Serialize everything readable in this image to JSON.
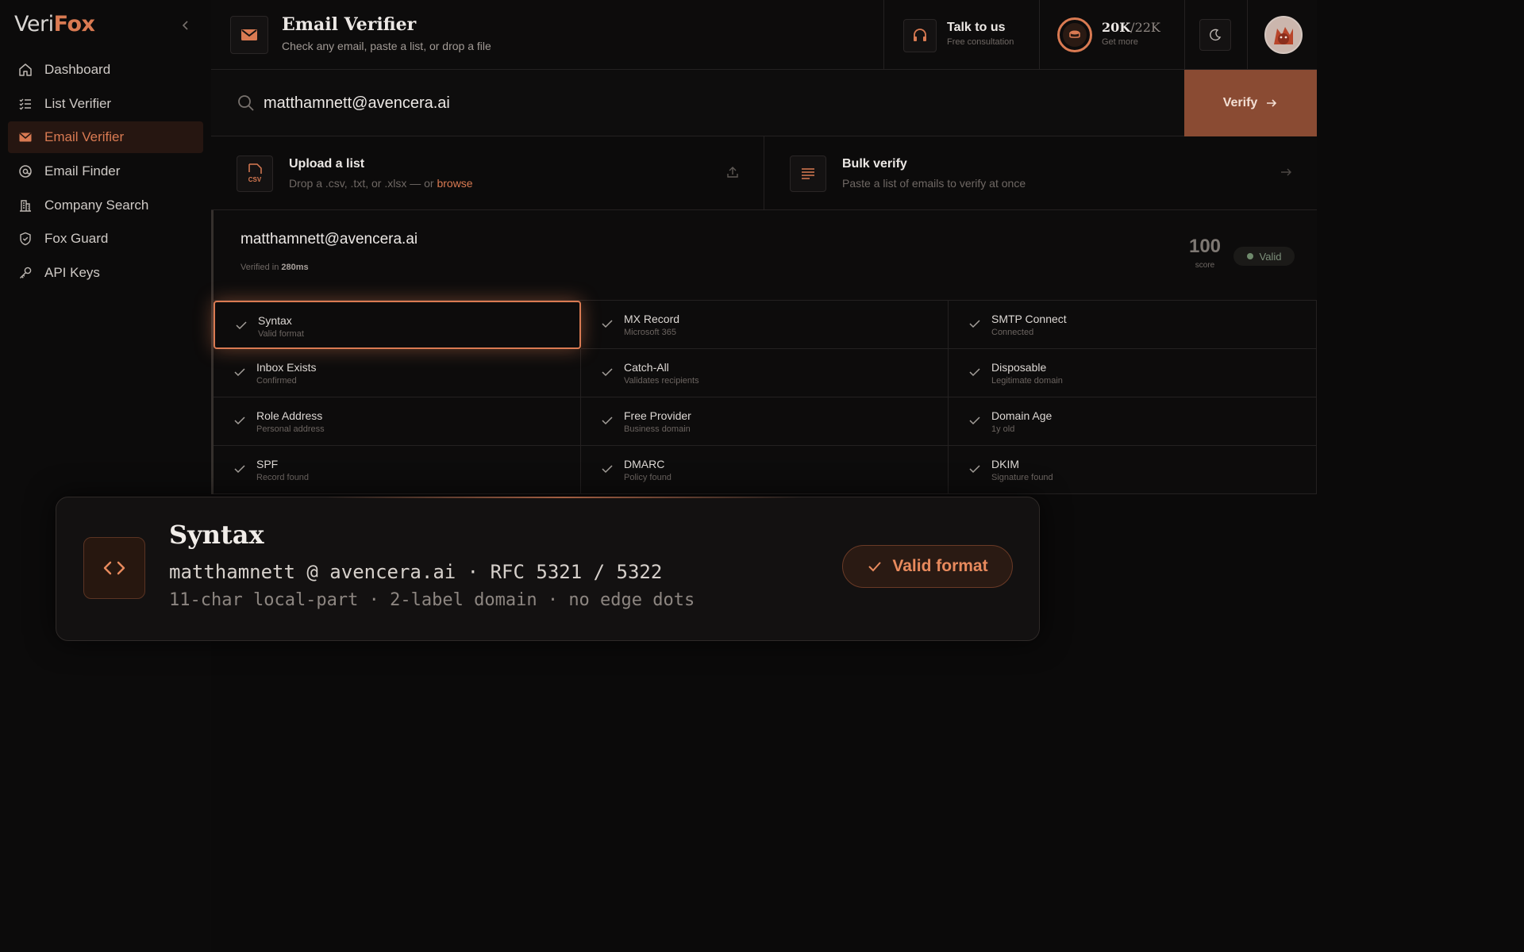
{
  "app": {
    "logo_part1": "Veri",
    "logo_part2": "Fox"
  },
  "colors": {
    "accent": "#d97a52",
    "verify_button": "#8a4b33",
    "background": "#0b0a0a",
    "valid_dot": "#6f8a6c"
  },
  "sidebar": {
    "items": [
      {
        "label": "Dashboard",
        "icon": "home-icon"
      },
      {
        "label": "List Verifier",
        "icon": "list-icon"
      },
      {
        "label": "Email Verifier",
        "icon": "mail-icon",
        "active": true
      },
      {
        "label": "Email Finder",
        "icon": "at-sign-icon"
      },
      {
        "label": "Company Search",
        "icon": "building-icon"
      },
      {
        "label": "Fox Guard",
        "icon": "shield-check-icon"
      },
      {
        "label": "API Keys",
        "icon": "key-icon"
      }
    ]
  },
  "header": {
    "title": "Email Verifier",
    "subtitle": "Check any email, paste a list, or drop a file",
    "talk_title": "Talk to us",
    "talk_sub": "Free consultation",
    "credits_used": "20K",
    "credits_total": "/22K",
    "credits_sub": "Get more"
  },
  "search": {
    "value": "matthamnett@avencera.ai",
    "button_label": "Verify"
  },
  "upload": {
    "title": "Upload a list",
    "sub_prefix": "Drop a .csv, .txt, or .xlsx — or ",
    "sub_link": "browse",
    "icon_text": "CSV"
  },
  "bulk": {
    "title": "Bulk verify",
    "sub": "Paste a list of emails to verify at once"
  },
  "result": {
    "email": "matthamnett@avencera.ai",
    "verified_prefix": "Verified in ",
    "verified_time": "280ms",
    "score": "100",
    "score_label": "score",
    "status": "Valid",
    "checks": [
      {
        "title": "Syntax",
        "sub": "Valid format",
        "highlighted": true
      },
      {
        "title": "MX Record",
        "sub": "Microsoft 365"
      },
      {
        "title": "SMTP Connect",
        "sub": "Connected"
      },
      {
        "title": "Inbox Exists",
        "sub": "Confirmed"
      },
      {
        "title": "Catch-All",
        "sub": "Validates recipients"
      },
      {
        "title": "Disposable",
        "sub": "Legitimate domain"
      },
      {
        "title": "Role Address",
        "sub": "Personal address"
      },
      {
        "title": "Free Provider",
        "sub": "Business domain"
      },
      {
        "title": "Domain Age",
        "sub": "1y old"
      },
      {
        "title": "SPF",
        "sub": "Record found"
      },
      {
        "title": "DMARC",
        "sub": "Policy found"
      },
      {
        "title": "DKIM",
        "sub": "Signature found"
      }
    ]
  },
  "tooltip": {
    "title": "Syntax",
    "line1": "matthamnett @ avencera.ai · RFC 5321 / 5322",
    "line2": "11-char local-part · 2-label domain · no edge dots",
    "badge": "Valid format"
  }
}
